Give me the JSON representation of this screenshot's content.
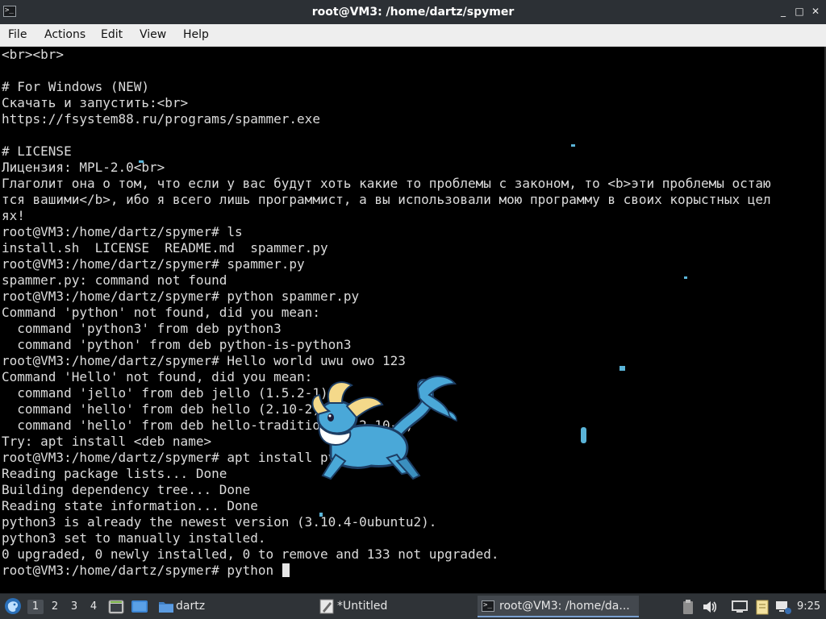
{
  "window": {
    "title": "root@VM3: /home/dartz/spymer",
    "app_icon": "terminal-icon",
    "controls": {
      "minimize": "_",
      "maximize": "□",
      "close": "✕"
    }
  },
  "menu": [
    "File",
    "Actions",
    "Edit",
    "View",
    "Help"
  ],
  "terminal": {
    "lines": [
      "<br><br>",
      "",
      "# For Windows (NEW)",
      "Скачать и запустить:<br>",
      "https://fsystem88.ru/programs/spammer.exe",
      "",
      "# LICENSE",
      "Лицензия: MPL-2.0<br>",
      "Глаголит она о том, что если у вас будут хоть какие то проблемы с законом, то <b>эти проблемы остаю",
      "тся вашими</b>, ибо я всего лишь программист, а вы использовали мою программу в своих корыстных цел",
      "ях!",
      "root@VM3:/home/dartz/spymer# ls",
      "install.sh  LICENSE  README.md  spammer.py",
      "root@VM3:/home/dartz/spymer# spammer.py",
      "spammer.py: command not found",
      "root@VM3:/home/dartz/spymer# python spammer.py",
      "Command 'python' not found, did you mean:",
      "  command 'python3' from deb python3",
      "  command 'python' from deb python-is-python3",
      "root@VM3:/home/dartz/spymer# Hello world uwu owo 123",
      "Command 'Hello' not found, did you mean:",
      "  command 'jello' from deb jello (1.5.2-1)",
      "  command 'hello' from deb hello (2.10-2)",
      "  command 'hello' from deb hello-traditional (2.10-5)",
      "Try: apt install <deb name>",
      "root@VM3:/home/dartz/spymer# apt install python3",
      "Reading package lists... Done",
      "Building dependency tree... Done",
      "Reading state information... Done",
      "python3 is already the newest version (3.10.4-0ubuntu2).",
      "python3 set to manually installed.",
      "0 upgraded, 0 newly installed, 0 to remove and 133 not upgraded."
    ],
    "prompt_line": "root@VM3:/home/dartz/spymer# python "
  },
  "desktop_pet": {
    "name": "vaporeon-pet",
    "colors": {
      "body": "#4aa8d8",
      "fin": "#f4d98a",
      "collar": "#ffffff",
      "outline": "#1d3d63"
    }
  },
  "taskbar": {
    "start_icon": "start-menu-icon",
    "workspaces": [
      "1",
      "2",
      "3",
      "4"
    ],
    "active_workspace": "1",
    "quicklaunch": [
      {
        "name": "terminal-launcher-icon"
      },
      {
        "name": "show-desktop-icon"
      }
    ],
    "tasks": [
      {
        "label": "dartz",
        "icon": "folder-icon"
      },
      {
        "label": "*Untitled",
        "icon": "text-editor-icon"
      },
      {
        "label": "root@VM3: /home/da...",
        "icon": "terminal-icon",
        "active": true
      }
    ],
    "tray_icons": [
      "clipboard-icon",
      "volume-icon",
      "display-icon",
      "notes-icon",
      "network-icon",
      "battery-icon"
    ],
    "clock": "9:25"
  }
}
